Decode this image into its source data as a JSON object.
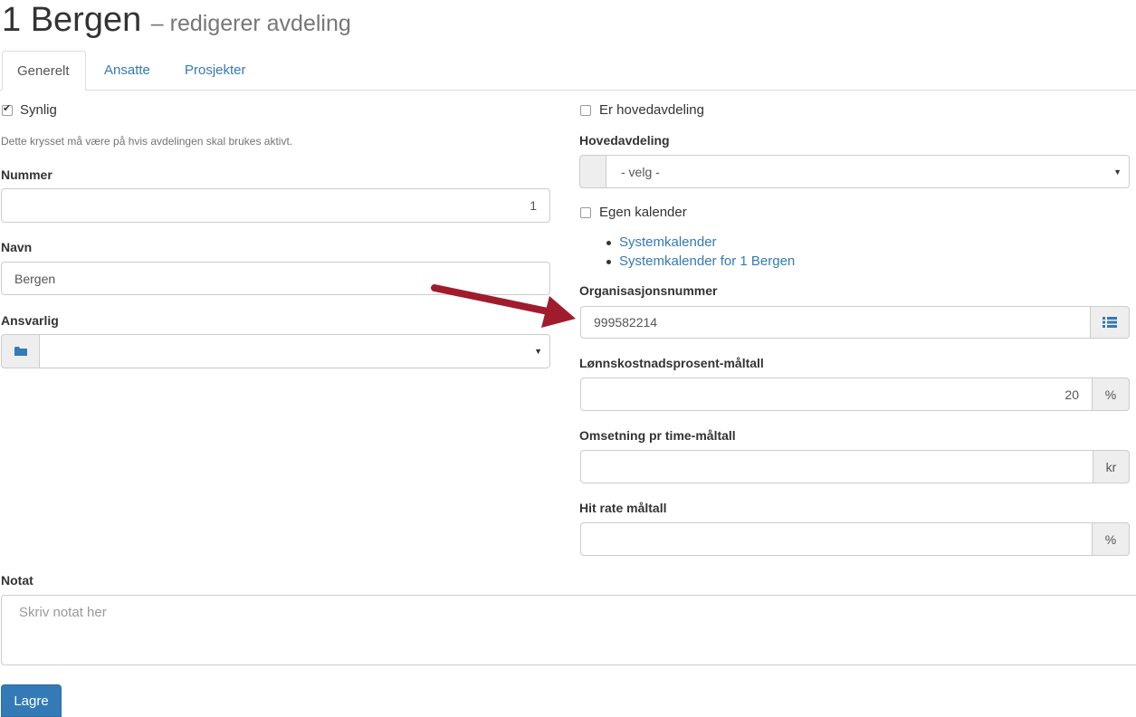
{
  "header": {
    "title": "1 Bergen",
    "subtitle": "– redigerer avdeling"
  },
  "tabs": [
    {
      "label": "Generelt",
      "active": true
    },
    {
      "label": "Ansatte",
      "active": false
    },
    {
      "label": "Prosjekter",
      "active": false
    }
  ],
  "left": {
    "synlig": {
      "label": "Synlig",
      "checked": true,
      "help": "Dette krysset må være på hvis avdelingen skal brukes aktivt."
    },
    "nummer": {
      "label": "Nummer",
      "value": "1"
    },
    "navn": {
      "label": "Navn",
      "value": "Bergen"
    },
    "ansvarlig": {
      "label": "Ansvarlig",
      "value": ""
    }
  },
  "right": {
    "hovedavdeling_check": {
      "label": "Er hovedavdeling",
      "checked": false
    },
    "hovedavdeling": {
      "label": "Hovedavdeling",
      "value": "- velg -"
    },
    "egen_kalender": {
      "label": "Egen kalender",
      "checked": false
    },
    "calendar_links": [
      "Systemkalender",
      "Systemkalender for 1 Bergen"
    ],
    "orgnr": {
      "label": "Organisasjonsnummer",
      "value": "999582214"
    },
    "lonn": {
      "label": "Lønnskostnadsprosent-måltall",
      "value": "20",
      "unit": "%"
    },
    "omsetning": {
      "label": "Omsetning pr time-måltall",
      "value": "",
      "unit": "kr"
    },
    "hitrate": {
      "label": "Hit rate måltall",
      "value": "",
      "unit": "%"
    }
  },
  "notat": {
    "label": "Notat",
    "placeholder": "Skriv notat her"
  },
  "save_button": "Lagre",
  "colors": {
    "primary": "#337ab7",
    "arrow": "#a01c2c"
  },
  "icons": {
    "ansvarlig_addon": "folder-icon",
    "orgnr_addon": "list-icon"
  }
}
